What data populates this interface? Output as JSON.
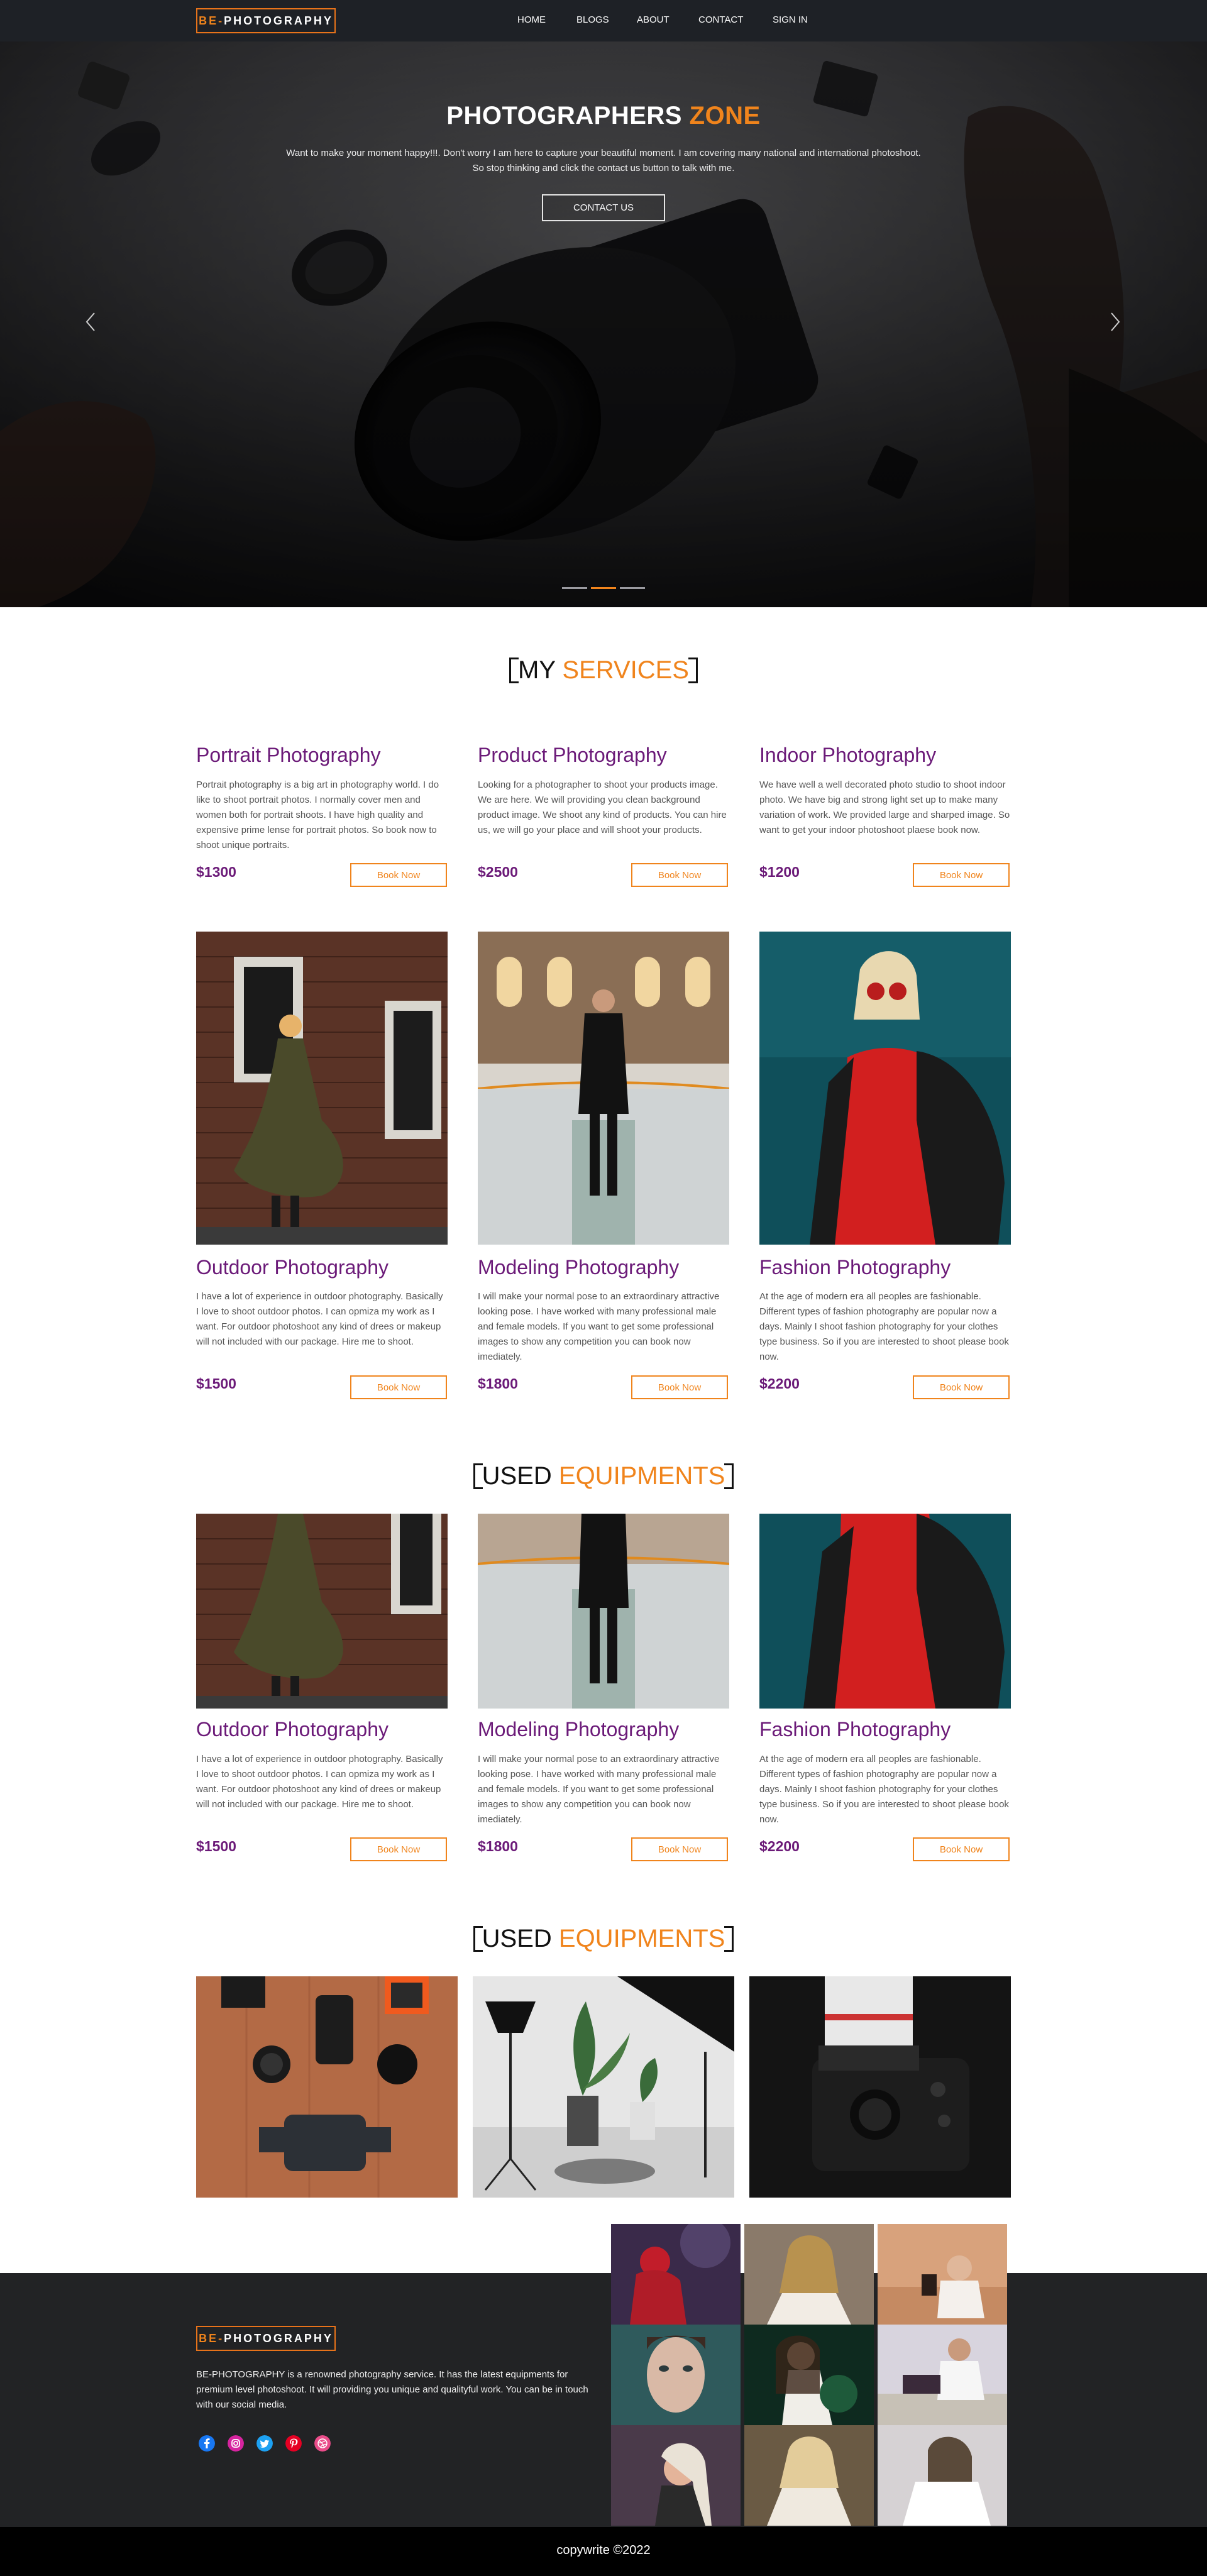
{
  "nav": {
    "logo_prefix": "BE-",
    "logo_rest": "PHOTOGRAPHY",
    "links": [
      "HOME",
      "BLOGS",
      "ABOUT",
      "CONTACT",
      "SIGN IN"
    ]
  },
  "hero": {
    "title_main": "PHOTOGRAPHERS",
    "title_accent": "ZONE",
    "text_line1": "Want to make your moment happy!!!. Don't worry I am here to capture your beautiful moment. I am covering many national and international photoshoot.",
    "text_line2": "So stop thinking and click the contact us button to talk with me.",
    "button": "CONTACT US",
    "slides": 3,
    "active_slide": 2
  },
  "services": {
    "title_main": "MY",
    "title_accent": "SERVICES",
    "row1": [
      {
        "title": "Portrait Photography",
        "text": "Portrait photography is a big art in photography world. I do like to shoot portrait photos. I normally cover men and women both for portrait shoots. I have high quality and expensive prime lense for portrait photos. So book now to shoot unique portraits.",
        "price": "$1300",
        "button": "Book Now"
      },
      {
        "title": "Product Photography",
        "text": "Looking for a photographer to shoot your products image. We are here. We will providing you clean background product image. We shoot any kind of products. You can hire us, we will go your place and will shoot your products.",
        "price": "$2500",
        "button": "Book Now"
      },
      {
        "title": "Indoor Photography",
        "text": "We have well a well decorated photo studio to shoot indoor photo. We have big and strong light set up to make many variation of work. We provided large and sharped image. So want to get your indoor photoshoot plaese book now.",
        "price": "$1200",
        "button": "Book Now"
      }
    ],
    "row2": [
      {
        "title": "Outdoor Photography",
        "text": "I have a lot of experience in outdoor photography. Basically I love to shoot outdoor photos. I can opmiza my work as I want. For outdoor photoshoot any kind of drees or makeup will not included with our package. Hire me to shoot.",
        "price": "$1500",
        "button": "Book Now"
      },
      {
        "title": "Modeling Photography",
        "text": "I will make your normal pose to an extraordinary attractive looking pose. I have worked with many professional male and female models. If you want to get some professional images to show any competition you can book now imediately.",
        "price": "$1800",
        "button": "Book Now"
      },
      {
        "title": "Fashion Photography",
        "text": "At the age of modern era all peoples are fashionable. Different types of fashion photography are popular now a days. Mainly I shoot fashion photography for your clothes type business. So if you are interested to shoot please book now.",
        "price": "$2200",
        "button": "Book Now"
      }
    ]
  },
  "equipments1": {
    "title_main": "USED",
    "title_accent": "EQUIPMENTS",
    "cards": [
      {
        "title": "Outdoor Photography",
        "text": "I have a lot of experience in outdoor photography. Basically I love to shoot outdoor photos. I can opmiza my work as I want. For outdoor photoshoot any kind of drees or makeup will not included with our package. Hire me to shoot.",
        "price": "$1500",
        "button": "Book Now"
      },
      {
        "title": "Modeling Photography",
        "text": "I will make your normal pose to an extraordinary attractive looking pose. I have worked with many professional male and female models. If you want to get some professional images to show any competition you can book now imediately.",
        "price": "$1800",
        "button": "Book Now"
      },
      {
        "title": "Fashion Photography",
        "text": "At the age of modern era all peoples are fashionable. Different types of fashion photography are popular now a days. Mainly I shoot fashion photography for your clothes type business. So if you are interested to shoot please book now.",
        "price": "$2200",
        "button": "Book Now"
      }
    ]
  },
  "equipments2": {
    "title_main": "USED",
    "title_accent": "EQUIPMENTS"
  },
  "footer": {
    "logo_prefix": "BE-",
    "logo_rest": "PHOTOGRAPHY",
    "text": "BE-PHOTOGRAPHY is a renowned photography service. It has the latest equipments for premium level photoshoot. It will providing you unique and qualityful work. You can be in touch with our social media.",
    "social_icons": [
      "facebook-icon",
      "instagram-icon",
      "twitter-icon",
      "pinterest-icon",
      "dribbble-icon"
    ],
    "copyright": "copywrite ©2022"
  },
  "colors": {
    "accent": "#f0841c",
    "purple": "#6b1a78",
    "nav_bg": "#1e2126",
    "footer_bg": "#222325"
  }
}
